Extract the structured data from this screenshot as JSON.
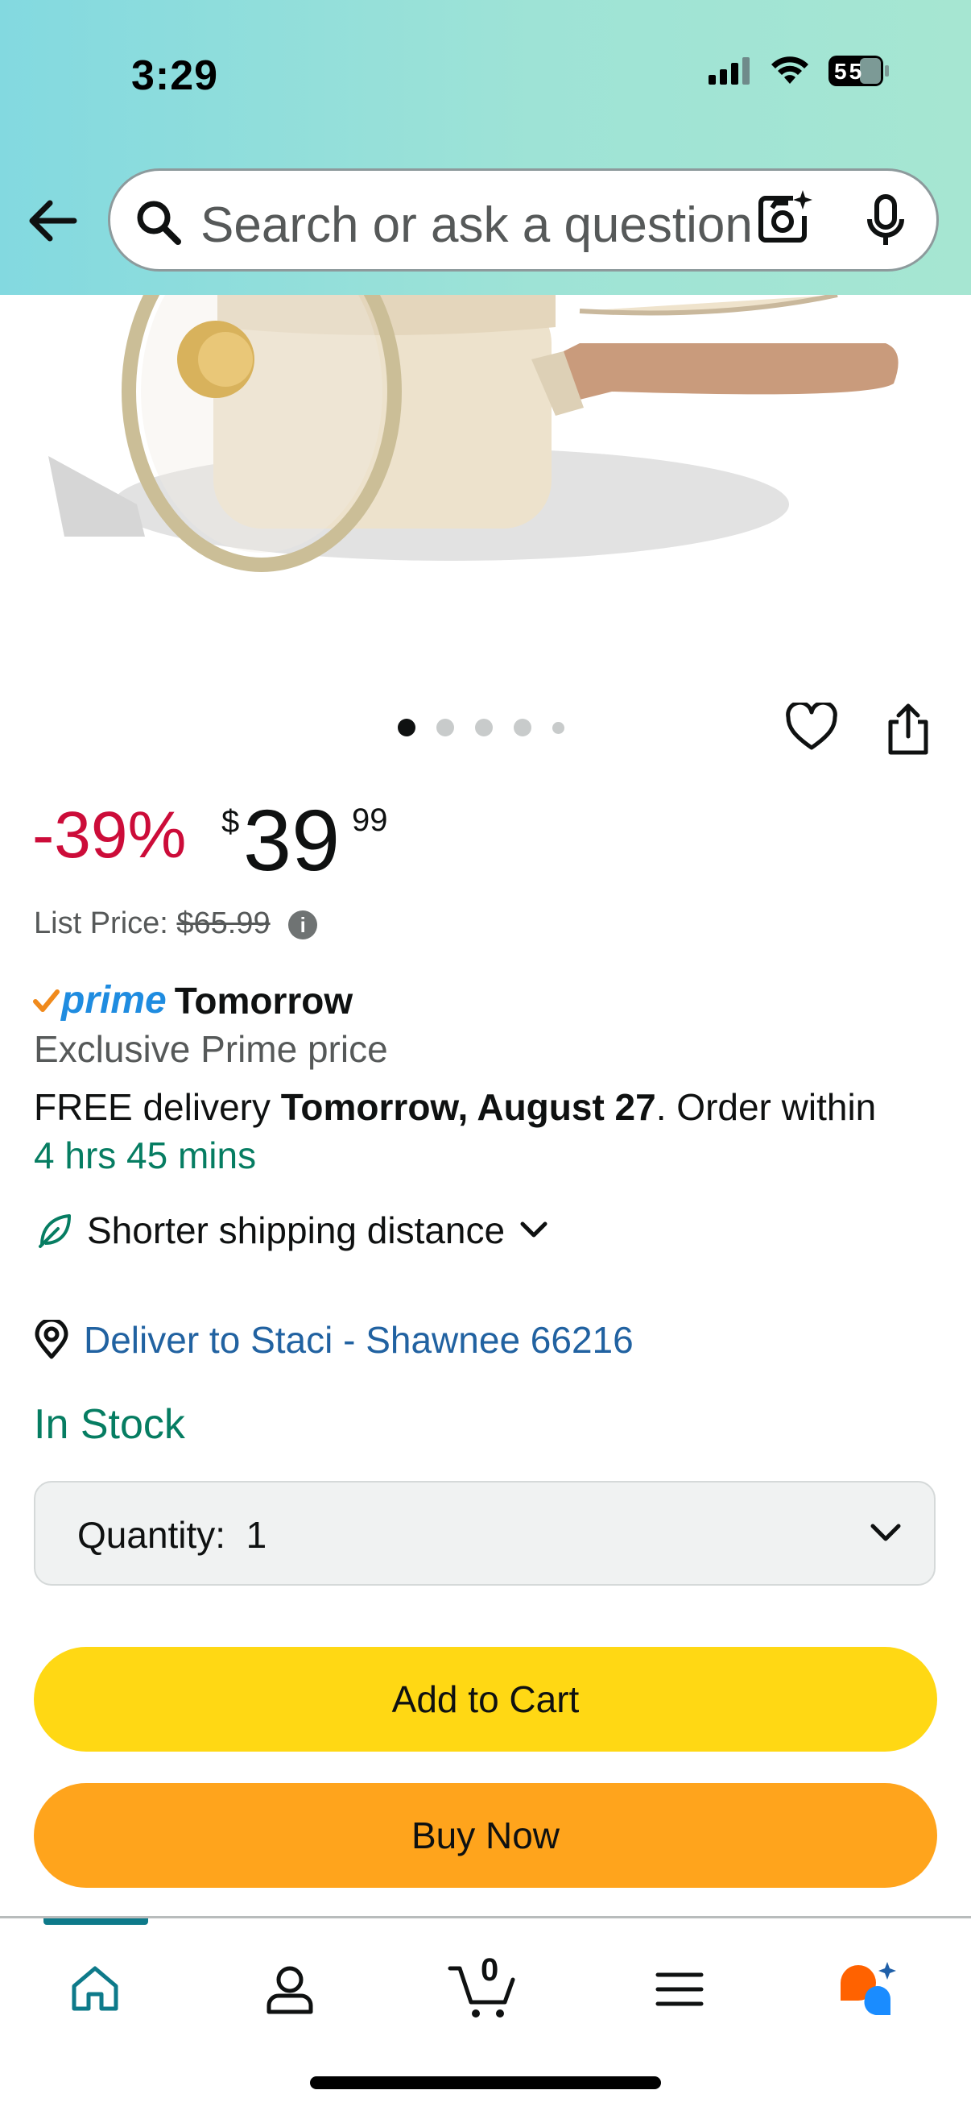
{
  "status_bar": {
    "time": "3:29",
    "battery": "55"
  },
  "search": {
    "placeholder": "Search or ask a question"
  },
  "product": {
    "discount": "-39%",
    "price_symbol": "$",
    "price_whole": "39",
    "price_fraction": "99",
    "list_price_label": "List Price:",
    "list_price_value": "$65.99",
    "info_icon": "i"
  },
  "carousel": {
    "total": 5,
    "active_index": 0
  },
  "delivery": {
    "prime_label": "prime",
    "prime_day": "Tomorrow",
    "exclusive": "Exclusive Prime price",
    "free_prefix": "FREE delivery ",
    "date": "Tomorrow, August 27",
    "order_within_text": ". Order within",
    "countdown": "4 hrs 45 mins",
    "shipping_note": "Shorter shipping distance",
    "deliver_to": "Deliver to Staci - Shawnee 66216"
  },
  "stock": {
    "status": "In Stock"
  },
  "quantity": {
    "label": "Quantity:",
    "value": "1"
  },
  "buttons": {
    "add_to_cart": "Add to Cart",
    "buy_now": "Buy Now"
  },
  "nav": {
    "cart_count": "0",
    "active_tab": "home"
  },
  "colors": {
    "discount": "#cc0c39",
    "green": "#067d62",
    "link": "#2162a1",
    "add_to_cart": "#ffd814",
    "buy_now": "#ffa41c",
    "prime_blue": "#1f8ce0",
    "header_gradient": "#83d9e0"
  },
  "icons": [
    "back-arrow-icon",
    "search-icon",
    "camera-lens-icon",
    "microphone-icon",
    "heart-icon",
    "share-icon",
    "leaf-icon",
    "chevron-down-icon",
    "location-pin-icon",
    "home-icon",
    "account-icon",
    "cart-icon",
    "menu-icon",
    "rufus-icon"
  ]
}
